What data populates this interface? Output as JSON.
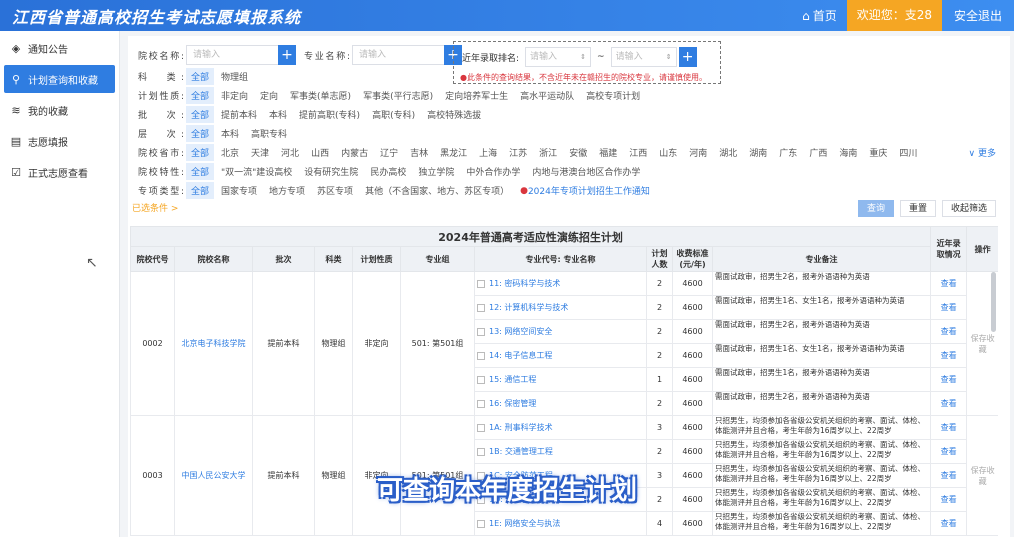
{
  "app": {
    "title": "江西省普通高校招生考试志愿填报系统",
    "home": "首页",
    "welcome": "欢迎您：支28",
    "logout": "安全退出"
  },
  "sidebar": {
    "items": [
      {
        "label": "通知公告",
        "icon": "cube-icon",
        "active": false
      },
      {
        "label": "计划查询和收藏",
        "icon": "search-list-icon",
        "active": true
      },
      {
        "label": "我的收藏",
        "icon": "layers-icon",
        "active": false
      },
      {
        "label": "志愿填报",
        "icon": "edit-doc-icon",
        "active": false
      },
      {
        "label": "正式志愿查看",
        "icon": "check-doc-icon",
        "active": false
      }
    ]
  },
  "filters": {
    "school_label": "院校名称:",
    "school_placeholder": "请输入",
    "major_label": "专业名称:",
    "major_placeholder": "请输入",
    "rank_label": "近年录取排名:",
    "rank_from_placeholder": "请输入",
    "rank_to_placeholder": "请输入",
    "rank_sep": "~",
    "rank_tip": "●此条件的查询结果，不含近年未在赣招生的院校专业，请谨慎使用。",
    "rows": [
      {
        "label": "科　类:",
        "options": [
          "全部",
          "物理组"
        ]
      },
      {
        "label": "计划性质:",
        "options": [
          "全部",
          "非定向",
          "定向",
          "军事类(单志愿)",
          "军事类(平行志愿)",
          "定向培养军士生",
          "高水平运动队",
          "高校专项计划"
        ]
      },
      {
        "label": "批　次:",
        "options": [
          "全部",
          "提前本科",
          "本科",
          "提前高职(专科)",
          "高职(专科)",
          "高校特殊选拔"
        ]
      },
      {
        "label": "层　次:",
        "options": [
          "全部",
          "本科",
          "高职专科"
        ]
      },
      {
        "label": "院校省市:",
        "options": [
          "全部",
          "北京",
          "天津",
          "河北",
          "山西",
          "内蒙古",
          "辽宁",
          "吉林",
          "黑龙江",
          "上海",
          "江苏",
          "浙江",
          "安徽",
          "福建",
          "江西",
          "山东",
          "河南",
          "湖北",
          "湖南",
          "广东",
          "广西",
          "海南",
          "重庆",
          "四川"
        ]
      },
      {
        "label": "院校特性:",
        "options": [
          "全部",
          "\"双一流\"建设高校",
          "设有研究生院",
          "民办高校",
          "独立学院",
          "中外合作办学",
          "内地与港澳台地区合作办学"
        ]
      },
      {
        "label": "专项类型:",
        "options": [
          "全部",
          "国家专项",
          "地方专项",
          "苏区专项",
          "其他（不含国家、地方、苏区专项）"
        ]
      }
    ],
    "notice_link": "2024年专项计划招生工作通知",
    "more": "更多",
    "chosen": "已选条件 >",
    "buttons": {
      "query": "查询",
      "reset": "重置",
      "collapse": "收起筛选"
    }
  },
  "table": {
    "title": "2024年普通高考适应性演练招生计划",
    "headers": [
      "院校代号",
      "院校名称",
      "批次",
      "科类",
      "计划性质",
      "专业组",
      "专业代号: 专业名称",
      "计划人数",
      "收费标准(元/年)",
      "专业备注",
      "近年录取情况",
      "操作"
    ],
    "groups": [
      {
        "code": "0002",
        "name": "北京电子科技学院",
        "batch": "提前本科",
        "subject": "物理组",
        "nature": "非定向",
        "group": "501: 第501组",
        "action": "保存收藏",
        "rows": [
          {
            "major": "11: 密码科学与技术",
            "count": "2",
            "fee": "4600",
            "remark": "需面试政审，招男生2名，报考外语语种为英语",
            "view": "查看"
          },
          {
            "major": "12: 计算机科学与技术",
            "count": "2",
            "fee": "4600",
            "remark": "需面试政审，招男生1名、女生1名，报考外语语种为英语",
            "view": "查看"
          },
          {
            "major": "13: 网络空间安全",
            "count": "2",
            "fee": "4600",
            "remark": "需面试政审，招男生2名，报考外语语种为英语",
            "view": "查看"
          },
          {
            "major": "14: 电子信息工程",
            "count": "2",
            "fee": "4600",
            "remark": "需面试政审，招男生1名、女生1名，报考外语语种为英语",
            "view": "查看"
          },
          {
            "major": "15: 通信工程",
            "count": "1",
            "fee": "4600",
            "remark": "需面试政审，招男生1名，报考外语语种为英语",
            "view": "查看"
          },
          {
            "major": "16: 保密管理",
            "count": "2",
            "fee": "4600",
            "remark": "需面试政审，招男生2名，报考外语语种为英语",
            "view": "查看"
          }
        ]
      },
      {
        "code": "0003",
        "name": "中国人民公安大学",
        "batch": "提前本科",
        "subject": "物理组",
        "nature": "非定向",
        "group": "501: 第501组",
        "action": "保存收藏",
        "rows": [
          {
            "major": "1A: 刑事科学技术",
            "count": "3",
            "fee": "4600",
            "remark": "只招男生，均须参加各省级公安机关组织的考察、面试、体检、体能测评并且合格，考生年龄为16周岁以上、22周岁",
            "view": "查看"
          },
          {
            "major": "1B: 交通管理工程",
            "count": "2",
            "fee": "4600",
            "remark": "只招男生，均须参加各省级公安机关组织的考察、面试、体检、体能测评并且合格，考生年龄为16周岁以上、22周岁",
            "view": "查看"
          },
          {
            "major": "1C: 安全防范工程",
            "count": "3",
            "fee": "4600",
            "remark": "只招男生，均须参加各省级公安机关组织的考察、面试、体检、体能测评并且合格，考生年龄为16周岁以上、22周岁",
            "view": "查看"
          },
          {
            "major": "1D: 公安视听技术",
            "count": "2",
            "fee": "4600",
            "remark": "只招男生，均须参加各省级公安机关组织的考察、面试、体检、体能测评并且合格，考生年龄为16周岁以上、22周岁",
            "view": "查看"
          },
          {
            "major": "1E: 网络安全与执法",
            "count": "4",
            "fee": "4600",
            "remark": "只招男生，均须参加各省级公安机关组织的考察、面试、体检、体能测评并且合格，考生年龄为16周岁以上、22周岁",
            "view": "查看"
          }
        ]
      }
    ]
  },
  "overlay": {
    "subtitle": "可查询本年度招生计划"
  },
  "colors": {
    "primary": "#2f7de1",
    "header_bg": "#2a71d8",
    "welcome_bg": "#f5a623",
    "warning": "#d9363e"
  }
}
